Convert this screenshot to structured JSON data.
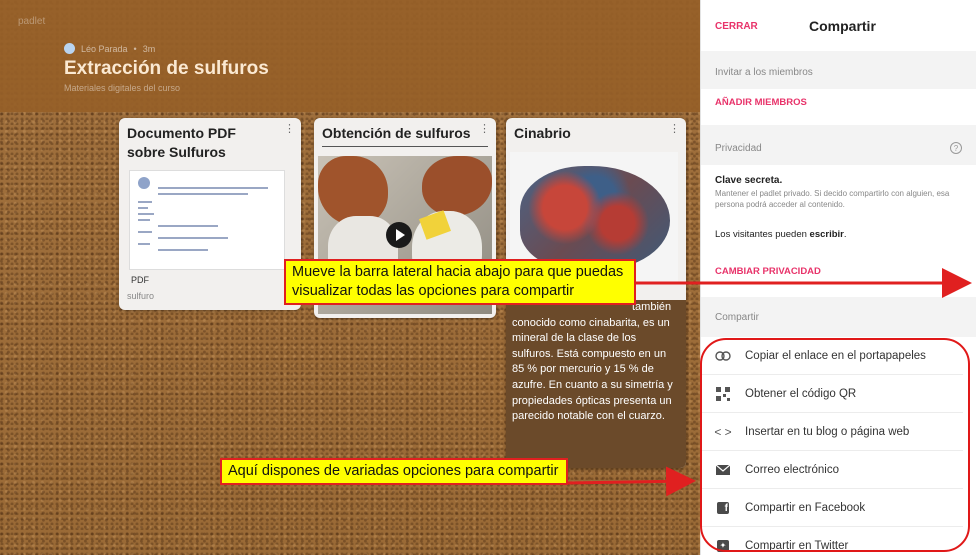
{
  "board": {
    "author": "Léo Parada",
    "time": "3m",
    "title": "Extracción de sulfuros",
    "subtitle": "Materiales digitales del curso"
  },
  "cards": {
    "pdf": {
      "title": "Documento PDF sobre Sulfuros",
      "file_type": "PDF",
      "caption": "sulfuro"
    },
    "video": {
      "title": "Obtención de sulfuros"
    },
    "mineral": {
      "title": "Cinabrio",
      "description": "también conocido como cinabarita, es un mineral de la clase de los sulfuros. Está compuesto en un 85 % por mercurio y 15 % de azufre. En cuanto a su simetría y propiedades ópticas presenta un parecido notable con el cuarzo."
    }
  },
  "panel": {
    "close_label": "CERRAR",
    "title": "Compartir",
    "invite_label": "Invitar a los miembros",
    "add_members_label": "AÑADIR MIEMBROS",
    "privacy_label": "Privacidad",
    "privacy_title": "Clave secreta.",
    "privacy_desc": "Mantener el padlet privado. Si decido compartirlo con alguien, esa persona podrá acceder al contenido.",
    "visitors_prefix": "Los visitantes pueden",
    "visitors_permission": "escribir",
    "change_privacy_label": "CAMBIAR PRIVACIDAD",
    "share_label": "Compartir",
    "share_items": [
      {
        "label": "Copiar el enlace en el portapapeles",
        "icon": "link-icon"
      },
      {
        "label": "Obtener el código QR",
        "icon": "qr-code-icon"
      },
      {
        "label": "Insertar en tu blog o página web",
        "icon": "code-icon"
      },
      {
        "label": "Correo electrónico",
        "icon": "envelope-icon"
      },
      {
        "label": "Compartir en Facebook",
        "icon": "facebook-icon"
      },
      {
        "label": "Compartir en Twitter",
        "icon": "twitter-icon"
      }
    ]
  },
  "annotations": {
    "scroll_note": "Mueve la barra lateral hacia abajo para que puedas visualizar todas las opciones para compartir",
    "options_note": "Aquí dispones de variadas opciones para compartir",
    "accent_color": "#e02020",
    "highlight_color": "#ffff00"
  }
}
